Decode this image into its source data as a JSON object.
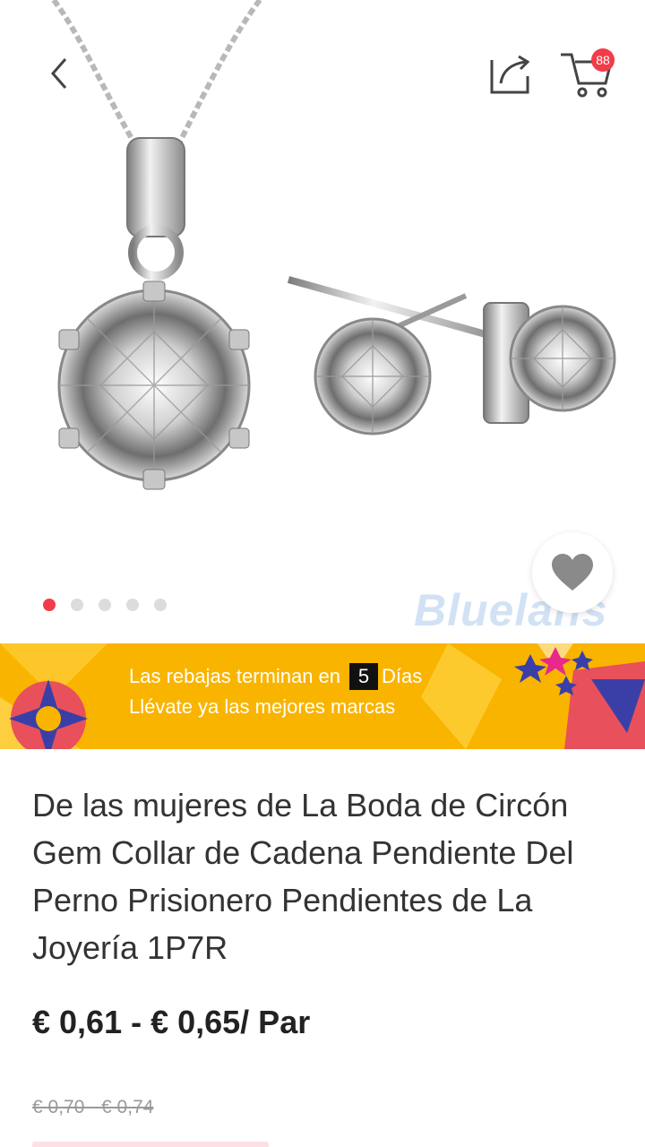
{
  "header": {
    "back_icon": "chevron-left-icon",
    "share_icon": "share-icon",
    "cart_icon": "shopping-cart-icon",
    "cart_count": "88"
  },
  "gallery": {
    "slide_count": 5,
    "active_slide": 1,
    "watermark": "Bluelans",
    "favorite_icon": "heart-icon"
  },
  "promo": {
    "line1_prefix": "Las rebajas terminan en",
    "days_value": "5",
    "line1_suffix": "Días",
    "line2": "Llévate ya las mejores marcas"
  },
  "product": {
    "title": "De las mujeres de La Boda de Circón Gem Collar de Cadena Pendiente Del Perno Prisionero Pendientes de La Joyería 1P7R",
    "price": "€ 0,61 - € 0,65/ Par",
    "old_price": "€ 0,70 - € 0,74"
  },
  "colors": {
    "accent": "#f23c4a",
    "promo_bg": "#f9b400"
  }
}
